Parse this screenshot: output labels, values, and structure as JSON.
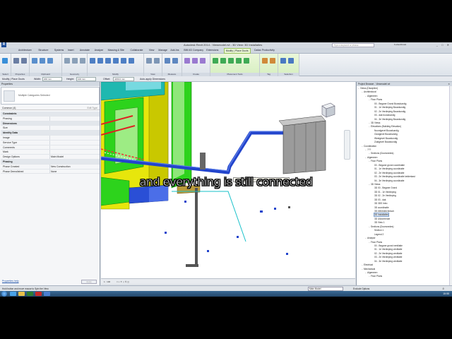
{
  "titlebar": {
    "logo": "R",
    "title": "Autodesk Revit 2014 - Viewmodel.rvt - 3D View: 3D Installaties",
    "search_placeholder": "Type a keyword or phrase",
    "user": "b.elsenbroek",
    "window_buttons": "_ □ ✕"
  },
  "ribbon_tabs": [
    "Architecture",
    "Structure",
    "Systems",
    "Insert",
    "Annotate",
    "Analyze",
    "Massing & Site",
    "Collaborate",
    "View",
    "Manage",
    "Add-Ins",
    "BIM 4D Company",
    "Extensions",
    "Modify | Place Ducts",
    "Cadac Productivity"
  ],
  "active_tab_index": 13,
  "ribbon_panels": [
    {
      "label": "Select"
    },
    {
      "label": "Properties"
    },
    {
      "label": "Clipboard"
    },
    {
      "label": "Geometry"
    },
    {
      "label": "Modify"
    },
    {
      "label": "View"
    },
    {
      "label": "Measure"
    },
    {
      "label": "Create"
    },
    {
      "label": "Placement Tools"
    },
    {
      "label": "Tag"
    },
    {
      "label": "Selection"
    }
  ],
  "optbar": {
    "context": "Modify | Place Ducts",
    "width_label": "Width:",
    "width_value": "200 mm",
    "height_label": "Height:",
    "height_value": "100 mm",
    "offset_label": "Offset:",
    "offset_value": "4150.0 mm",
    "apply_label": "Auto-apply Dimensions"
  },
  "properties": {
    "header": "Properties",
    "type_name": "Multiple Categories Selected",
    "filter_text": "Common (4)",
    "edit_type": "Edit Type",
    "rows": [
      {
        "k": "Constraints",
        "v": "",
        "group": true
      },
      {
        "k": "Phasing",
        "v": ""
      },
      {
        "k": "Dimensions",
        "v": "",
        "group": true
      },
      {
        "k": "Size",
        "v": ""
      },
      {
        "k": "Identity Data",
        "v": "",
        "group": true
      },
      {
        "k": "Image",
        "v": ""
      },
      {
        "k": "Service Type",
        "v": ""
      },
      {
        "k": "Comments",
        "v": ""
      },
      {
        "k": "Mark",
        "v": ""
      },
      {
        "k": "Design Options",
        "v": "Main Model"
      },
      {
        "k": "Phasing",
        "v": "",
        "group": true
      },
      {
        "k": "Phase Created",
        "v": "New Construction"
      },
      {
        "k": "Phase Demolished",
        "v": "None"
      }
    ],
    "help": "Properties help",
    "apply": "Apply"
  },
  "viewport": {
    "tooltip": "Hold button and move mouse to Spin the View.",
    "viewcube_label": "FRONT"
  },
  "viewctrl": {
    "scale": "1 : 100",
    "icons": "□ ◐ ☀ ◇ ⚲ ◫"
  },
  "browser": {
    "header": "Project Browser - Viewmodel.rvt",
    "close": "✕",
    "nodes": [
      {
        "label": "Views (Discipline)",
        "d": 0
      },
      {
        "label": "Architectural",
        "d": 1
      },
      {
        "label": "Algemeen",
        "d": 2
      },
      {
        "label": "Floor Plans",
        "d": 3
      },
      {
        "label": "00 - Begane Grond Bouwkundig",
        "d": 4
      },
      {
        "label": "01 - 1e Verdieping Bouwkundig",
        "d": 4
      },
      {
        "label": "02 - 2e Verdieping Bouwkundig",
        "d": 4
      },
      {
        "label": "03 - dak bouwkundig",
        "d": 4
      },
      {
        "label": "04 - 3e Verdieping Bouwkundig",
        "d": 4
      },
      {
        "label": "3D Views",
        "d": 3
      },
      {
        "label": "Elevations (Building Elevation)",
        "d": 3
      },
      {
        "label": "Noordgevel Bouwkundig",
        "d": 4
      },
      {
        "label": "Oostgevel Bouwkundig",
        "d": 4
      },
      {
        "label": "Westgevel Bouwkundig",
        "d": 4
      },
      {
        "label": "Zuidgevel Bouwkundig",
        "d": 4
      },
      {
        "label": "Coordination",
        "d": 1
      },
      {
        "label": "???",
        "d": 2
      },
      {
        "label": "Sections (Doorsnedes)",
        "d": 3
      },
      {
        "label": "Algemeen",
        "d": 2
      },
      {
        "label": "Floor Plans",
        "d": 3
      },
      {
        "label": "00 - Begane grond coordinatie",
        "d": 4
      },
      {
        "label": "01 - 1e Verdieping coordinatie",
        "d": 4
      },
      {
        "label": "02 - 2e Verdieping coordinatie",
        "d": 4
      },
      {
        "label": "03 - 2e Verdieping coordinatie kelderkast",
        "d": 4
      },
      {
        "label": "04 - 3e Verdieping coordinatie",
        "d": 4
      },
      {
        "label": "3D Views",
        "d": 3
      },
      {
        "label": "3D 00 - Begane Grond",
        "d": 4
      },
      {
        "label": "3D 01 - 1e Verdieping",
        "d": 4
      },
      {
        "label": "3D 02 - 2e Verdieping",
        "d": 4
      },
      {
        "label": "3D 03 - dak",
        "d": 4
      },
      {
        "label": "3D 3DS Intro",
        "d": 4
      },
      {
        "label": "3D coordinatie",
        "d": 4
      },
      {
        "label": "3D elektrotechnisch",
        "d": 4
      },
      {
        "label": "3D Installaties",
        "d": 4,
        "selected": true
      },
      {
        "label": "3D Uitvoerende",
        "d": 4
      },
      {
        "label": "3D View 1",
        "d": 4
      },
      {
        "label": "Sections (Doorsnedes)",
        "d": 3
      },
      {
        "label": "Section 1",
        "d": 4
      },
      {
        "label": "Legend 2",
        "d": 4
      },
      {
        "label": "Analyse",
        "d": 2
      },
      {
        "label": "Floor Plans",
        "d": 3
      },
      {
        "label": "00 - Begane grond ventilatie",
        "d": 4
      },
      {
        "label": "01 - 1e Verdieping ventilatie",
        "d": 4
      },
      {
        "label": "02 - 2e Verdieping ventilatie",
        "d": 4
      },
      {
        "label": "03 - 2e Verdieping ventilatie",
        "d": 4
      },
      {
        "label": "04 - 3e Verdieping ventilatie",
        "d": 4
      },
      {
        "label": "Electrical",
        "d": 1
      },
      {
        "label": "Mechanical",
        "d": 1
      },
      {
        "label": "Algemeen",
        "d": 2
      },
      {
        "label": "Floor Plans",
        "d": 3
      }
    ]
  },
  "statusbar": {
    "hint": "Hold button and move mouse to Spin the View.",
    "model": "Main Model",
    "exclude": "Exclude Options",
    "filter_count": ":0"
  },
  "taskbar": {
    "clock": "15:55"
  },
  "subtitle": "and everything is still connected",
  "colors": {
    "ribbon_context": "#e9f6d4",
    "duct_blue": "#2244cc",
    "pipe_green": "#2dd31c",
    "yellow": "#e7e60c",
    "selection": "#7ea0cc"
  }
}
